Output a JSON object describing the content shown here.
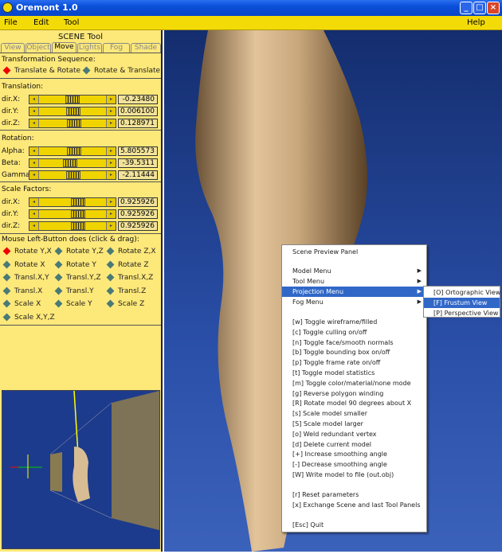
{
  "window": {
    "title": "Oremont 1.0"
  },
  "menubar": {
    "file": "File",
    "edit": "Edit",
    "tool": "Tool",
    "help": "Help"
  },
  "panel": {
    "title": "SCENE Tool",
    "tabs": [
      "View",
      "Object",
      "Move",
      "Lights",
      "Fog",
      "Shade"
    ],
    "active_tab": "Move",
    "sequence_label": "Transformation Sequence:",
    "sequence_options": [
      "Translate & Rotate",
      "Rotate & Translate"
    ],
    "sequence_selected": "Translate & Rotate",
    "translation": {
      "label": "Translation:",
      "rows": [
        {
          "name": "dir.X:",
          "value": "-0.23480",
          "pos": 0.5
        },
        {
          "name": "dir.Y:",
          "value": "0.006100",
          "pos": 0.52
        },
        {
          "name": "dir.Z:",
          "value": "0.128971",
          "pos": 0.53
        }
      ]
    },
    "rotation": {
      "label": "Rotation:",
      "rows": [
        {
          "name": "Alpha:",
          "value": "5.805573",
          "pos": 0.53
        },
        {
          "name": "Beta:",
          "value": "-39.5311",
          "pos": 0.45
        },
        {
          "name": "Gamma:",
          "value": "-2.11444",
          "pos": 0.51
        }
      ]
    },
    "scale": {
      "label": "Scale Factors:",
      "rows": [
        {
          "name": "dir.X:",
          "value": "0.925926",
          "pos": 0.6
        },
        {
          "name": "dir.Y:",
          "value": "0.925926",
          "pos": 0.6
        },
        {
          "name": "dir.Z:",
          "value": "0.925926",
          "pos": 0.6
        }
      ]
    },
    "mouse_label": "Mouse Left-Button does (click & drag):",
    "mouse_options": [
      "Rotate Y,X",
      "Rotate Y,Z",
      "Rotate Z,X",
      "Rotate X",
      "Rotate Y",
      "Rotate Z",
      "Transl.X,Y",
      "Transl.Y,Z",
      "Transl.X,Z",
      "Transl.X",
      "Transl.Y",
      "Transl.Z",
      "Scale X",
      "Scale Y",
      "Scale Z",
      "Scale X,Y,Z"
    ],
    "mouse_selected": "Rotate Y,X"
  },
  "context_menu": {
    "header": "Scene Preview Panel",
    "submenus": [
      "Model Menu",
      "Tool Menu",
      "Projection Menu",
      "Fog Menu"
    ],
    "highlighted": "Projection Menu",
    "commands": [
      "[w]   Toggle wireframe/filled",
      "[c]   Toggle culling on/off",
      "[n]   Toggle face/smooth normals",
      "[b]   Toggle bounding box on/off",
      "[p]   Toggle frame rate on/off",
      "[t]   Toggle model statistics",
      "[m]   Toggle color/material/none mode",
      "[g]   Reverse polygon winding",
      "[R]   Rotate model 90 degrees about X",
      "[s]   Scale model smaller",
      "[S]   Scale model larger",
      "[o]   Weld redundant vertex",
      "[d]   Delete current model",
      "[+]   Increase smoothing angle",
      "[-]   Decrease smoothing angle",
      "[W]   Write model to file (out.obj)"
    ],
    "extra": [
      "[r]   Reset parameters",
      "[x]   Exchange Scene and last Tool Panels"
    ],
    "quit": "[Esc]  Quit"
  },
  "projection_submenu": {
    "items": [
      "[O]   Ortographic View",
      "[F]   Frustum View",
      "[P]   Perspective View"
    ],
    "highlighted": "[F]   Frustum View"
  },
  "colors": {
    "panel": "#fde87a",
    "menubar": "#f3db08",
    "viewport": "#2a4fa8",
    "highlight": "#3168c8",
    "selected_radio": "#e00000"
  }
}
